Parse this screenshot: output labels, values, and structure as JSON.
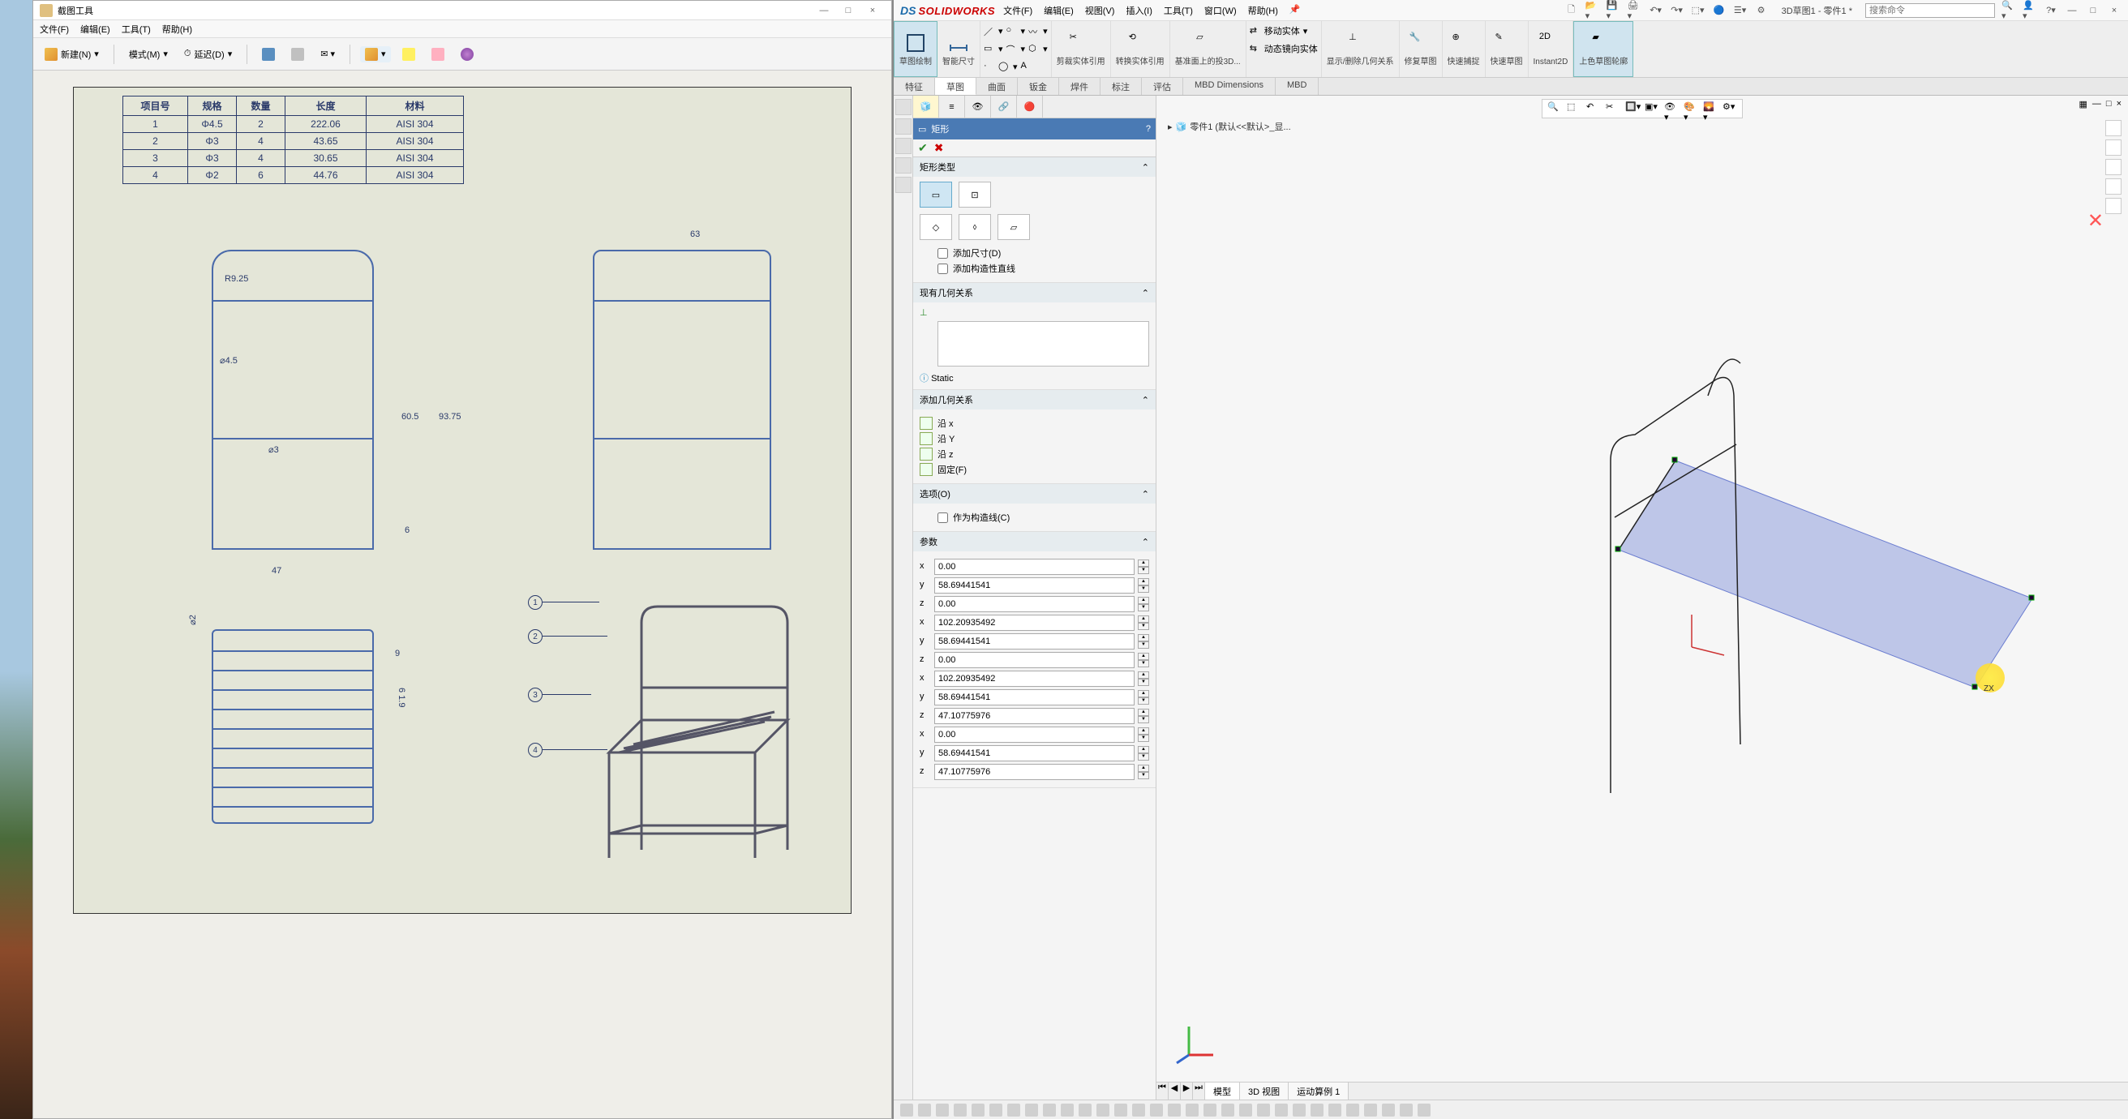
{
  "left_window": {
    "title": "截图工具",
    "menus": [
      "文件(F)",
      "编辑(E)",
      "工具(T)",
      "帮助(H)"
    ],
    "toolbar": {
      "new": "新建(N)",
      "mode": "模式(M)",
      "delay": "延迟(D)"
    },
    "window_controls": {
      "min": "—",
      "max": "□",
      "close": "×"
    }
  },
  "drawing": {
    "bom": {
      "headers": [
        "项目号",
        "规格",
        "数量",
        "长度",
        "材料"
      ],
      "rows": [
        [
          "1",
          "Φ4.5",
          "2",
          "222.06",
          "AISI 304"
        ],
        [
          "2",
          "Φ3",
          "4",
          "43.65",
          "AISI 304"
        ],
        [
          "3",
          "Φ3",
          "4",
          "30.65",
          "AISI 304"
        ],
        [
          "4",
          "Φ2",
          "6",
          "44.76",
          "AISI 304"
        ]
      ]
    },
    "dims": {
      "r": "R9.25",
      "d45": "⌀4.5",
      "d3": "⌀3",
      "w47": "47",
      "h605": "60.5",
      "h6": "6",
      "h9375": "93.75",
      "w63": "63",
      "d2": "⌀2",
      "s9": "9",
      "s619": "6 1.9"
    },
    "balloons": [
      "1",
      "2",
      "3",
      "4"
    ]
  },
  "sw": {
    "brand_ds": "DS",
    "brand_solid": "SOLIDWORKS",
    "menus": [
      "文件(F)",
      "编辑(E)",
      "视图(V)",
      "插入(I)",
      "工具(T)",
      "窗口(W)",
      "帮助(H)"
    ],
    "search_placeholder": "搜索命令",
    "doc_path": "3D草图1 - 零件1 *",
    "ribbon": {
      "big": [
        {
          "label": "草图绘制",
          "sel": true
        },
        {
          "label": "智能尺寸"
        },
        {
          "label": "剪裁实体引用"
        },
        {
          "label": "转换实体引用"
        },
        {
          "label": "基准面上的投3D..."
        },
        {
          "label": "移动实体"
        },
        {
          "label": "动态镜向实体"
        },
        {
          "label": "显示/删除几何关系"
        },
        {
          "label": "修复草图"
        },
        {
          "label": "快速捕捉"
        },
        {
          "label": "快速草图"
        },
        {
          "label": "Instant2D"
        },
        {
          "label": "上色草图轮廓",
          "sel": true
        }
      ]
    },
    "tabs": [
      "特征",
      "草图",
      "曲面",
      "钣金",
      "焊件",
      "标注",
      "评估",
      "MBD Dimensions",
      "MBD"
    ],
    "active_tab": "草图",
    "prop": {
      "title": "矩形",
      "sec_type": "矩形类型",
      "add_dim": "添加尺寸(D)",
      "add_constr_line": "添加构造性直线",
      "sec_existing": "现有几何关系",
      "static": "Static",
      "sec_add_rel": "添加几何关系",
      "rel_x": "沿 x",
      "rel_y": "沿 Y",
      "rel_z": "沿 z",
      "rel_fix": "固定(F)",
      "sec_options": "选项(O)",
      "as_constr": "作为构造线(C)",
      "sec_params": "参数",
      "params": [
        "0.00",
        "58.69441541",
        "0.00",
        "102.20935492",
        "58.69441541",
        "0.00",
        "102.20935492",
        "58.69441541",
        "47.10775976",
        "0.00",
        "58.69441541",
        "47.10775976"
      ]
    },
    "breadcrumb": "零件1 (默认<<默认>_显...",
    "cursor_label": "ZX",
    "bottom_tabs": [
      "模型",
      "3D 视图",
      "运动算例 1"
    ]
  }
}
